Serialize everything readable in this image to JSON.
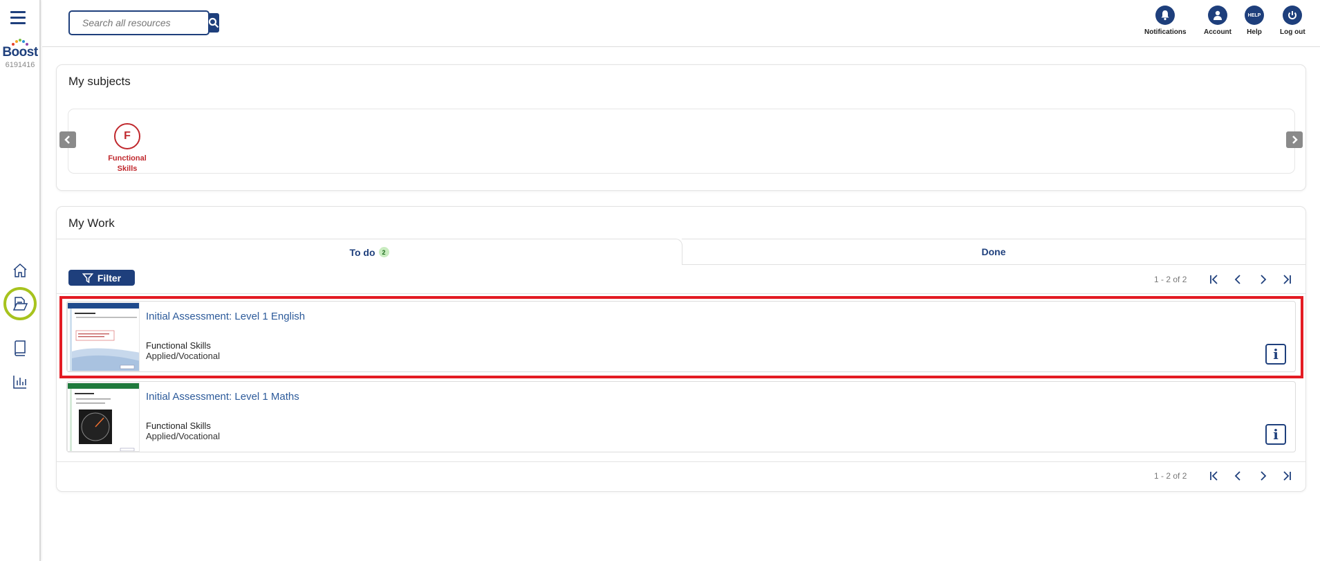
{
  "sidebar": {
    "logo_text": "Boost",
    "user_id": "6191416",
    "items": [
      {
        "icon": "home-icon"
      },
      {
        "icon": "document-folder-icon",
        "active": true
      },
      {
        "icon": "book-icon"
      },
      {
        "icon": "bar-chart-icon"
      }
    ]
  },
  "header": {
    "search_placeholder": "Search all resources",
    "nav": [
      {
        "label": "Notifications",
        "icon": "bell-icon"
      },
      {
        "label": "Account",
        "icon": "user-icon"
      },
      {
        "label": "Help",
        "icon": "help-icon",
        "icon_text": "HELP"
      },
      {
        "label": "Log out",
        "icon": "power-icon"
      }
    ]
  },
  "subjects": {
    "title": "My subjects",
    "items": [
      {
        "letter": "F",
        "label": "Functional Skills",
        "color": "#c0282d"
      }
    ]
  },
  "work": {
    "title": "My Work",
    "tabs": [
      {
        "label": "To do",
        "badge": "2"
      },
      {
        "label": "Done"
      }
    ],
    "filter_label": "Filter",
    "pager_text": "1 - 2 of 2",
    "items": [
      {
        "title": "Initial Assessment: Level 1 English",
        "subject": "Functional Skills",
        "category": "Applied/Vocational",
        "info": "i"
      },
      {
        "title": "Initial Assessment: Level 1 Maths",
        "subject": "Functional Skills",
        "category": "Applied/Vocational",
        "info": "i"
      }
    ]
  },
  "colors": {
    "brand": "#1e3f7c",
    "subject_red": "#c0282d",
    "highlight": "#e31b23",
    "active_ring": "#a7c31e"
  }
}
